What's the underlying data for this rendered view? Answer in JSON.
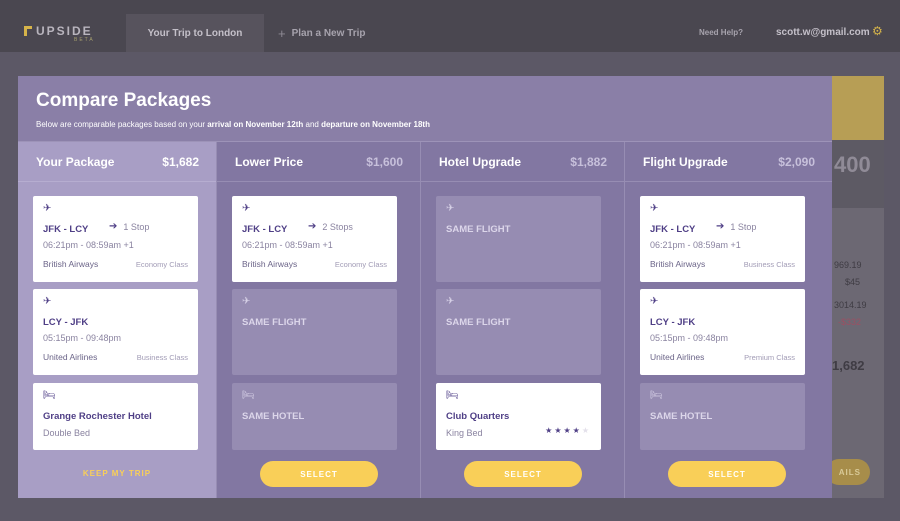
{
  "nav": {
    "logo": "UPSIDE",
    "logo_sub": "BETA",
    "tabs": [
      {
        "label": "Your Trip to London"
      },
      {
        "label": "Plan a New Trip"
      }
    ],
    "help": "Need Help?",
    "user_email": "scott.w@gmail.com",
    "icons": [
      "plus-icon",
      "gear-icon"
    ]
  },
  "background": {
    "big_value": "400",
    "lines": [
      "969.19",
      "$45",
      "3014.19",
      "-$332"
    ],
    "total": "1,682",
    "button": "AILS"
  },
  "modal": {
    "title": "Compare Packages",
    "subtitle_pre": "Below are comparable packages based on your ",
    "subtitle_b1": "arrival on November 12th",
    "subtitle_mid": " and ",
    "subtitle_b2": "departure on November 18th"
  },
  "packages": [
    {
      "name": "Your Package",
      "price": "$1,682",
      "flight_out": {
        "route": "JFK - LCY",
        "stops": "1 Stop",
        "times": "06:21pm - 08:59am +1",
        "airline": "British Airways",
        "class": "Economy Class"
      },
      "flight_back": {
        "route": "LCY - JFK",
        "times": "05:15pm - 09:48pm",
        "airline": "United Airlines",
        "class": "Business Class"
      },
      "hotel": {
        "name": "Grange Rochester Hotel",
        "room": "Double Bed"
      },
      "action": "KEEP MY TRIP"
    },
    {
      "name": "Lower Price",
      "price": "$1,600",
      "flight_out": {
        "route": "JFK - LCY",
        "stops": "2 Stops",
        "times": "06:21pm - 08:59am +1",
        "airline": "British Airways",
        "class": "Economy Class"
      },
      "flight_back": {
        "same": "SAME FLIGHT"
      },
      "hotel": {
        "same": "SAME HOTEL"
      },
      "action": "SELECT"
    },
    {
      "name": "Hotel Upgrade",
      "price": "$1,882",
      "flight_out": {
        "same": "SAME FLIGHT"
      },
      "flight_back": {
        "same": "SAME FLIGHT"
      },
      "hotel": {
        "name": "Club Quarters",
        "room": "King Bed",
        "stars": 4,
        "stars_max": 5
      },
      "action": "SELECT"
    },
    {
      "name": "Flight Upgrade",
      "price": "$2,090",
      "flight_out": {
        "route": "JFK - LCY",
        "stops": "1 Stop",
        "times": "06:21pm - 08:59am +1",
        "airline": "British Airways",
        "class": "Business Class"
      },
      "flight_back": {
        "route": "LCY - JFK",
        "times": "05:15pm - 09:48pm",
        "airline": "United Airlines",
        "class": "Premium Class"
      },
      "hotel": {
        "same": "SAME HOTEL"
      },
      "action": "SELECT"
    }
  ],
  "icons": {
    "depart": "plane-departure-icon",
    "arrive": "plane-arrival-icon",
    "hotel": "bed-icon",
    "stops": "arrow-right-icon",
    "star": "star-icon"
  },
  "colors": {
    "accent": "#f9cf58",
    "brand_purple": "#4f3f86",
    "modal_bg": "#8a7fa7",
    "current_column": "#a89ec5"
  }
}
